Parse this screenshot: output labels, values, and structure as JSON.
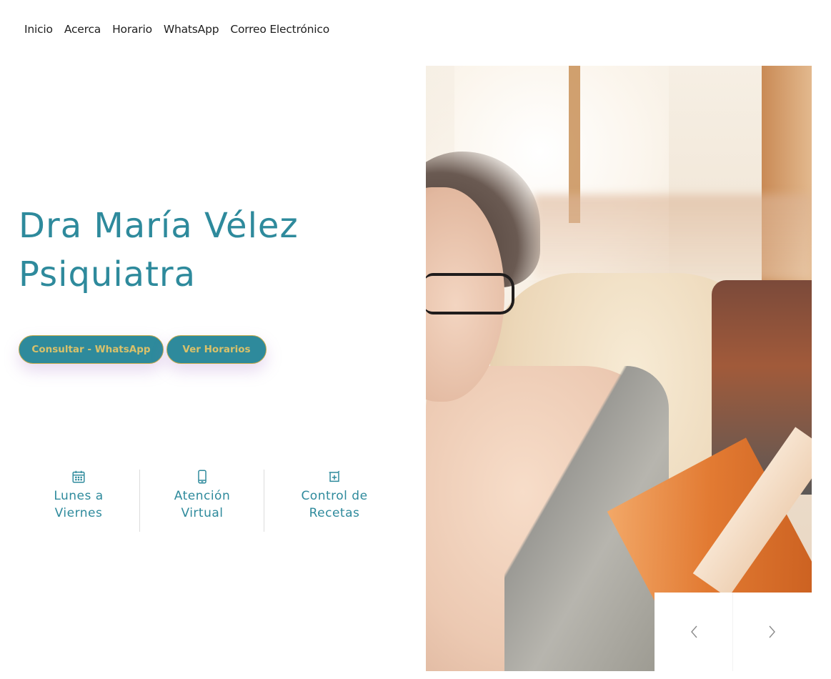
{
  "nav": {
    "items": [
      "Inicio",
      "Acerca",
      "Horario",
      "WhatsApp",
      "Correo Electrónico"
    ]
  },
  "hero": {
    "title_line1": "Dra María Vélez",
    "title_line2": "Psiquiatra",
    "cta_whatsapp": "Consultar - WhatsApp",
    "cta_schedule": "Ver Horarios"
  },
  "features": [
    {
      "icon": "calendar-icon",
      "label": "Lunes a\nViernes"
    },
    {
      "icon": "mobile-phone-icon",
      "label": "Atención\nVirtual"
    },
    {
      "icon": "prescription-icon",
      "label": "Control de\nRecetas"
    }
  ],
  "carousel": {
    "prev_icon": "chevron-left-icon",
    "next_icon": "chevron-right-icon"
  },
  "colors": {
    "accent": "#2e8a9c",
    "button_text": "#d9c16a",
    "button_border": "#c1a94a",
    "nav_text": "#1f1f1f"
  }
}
